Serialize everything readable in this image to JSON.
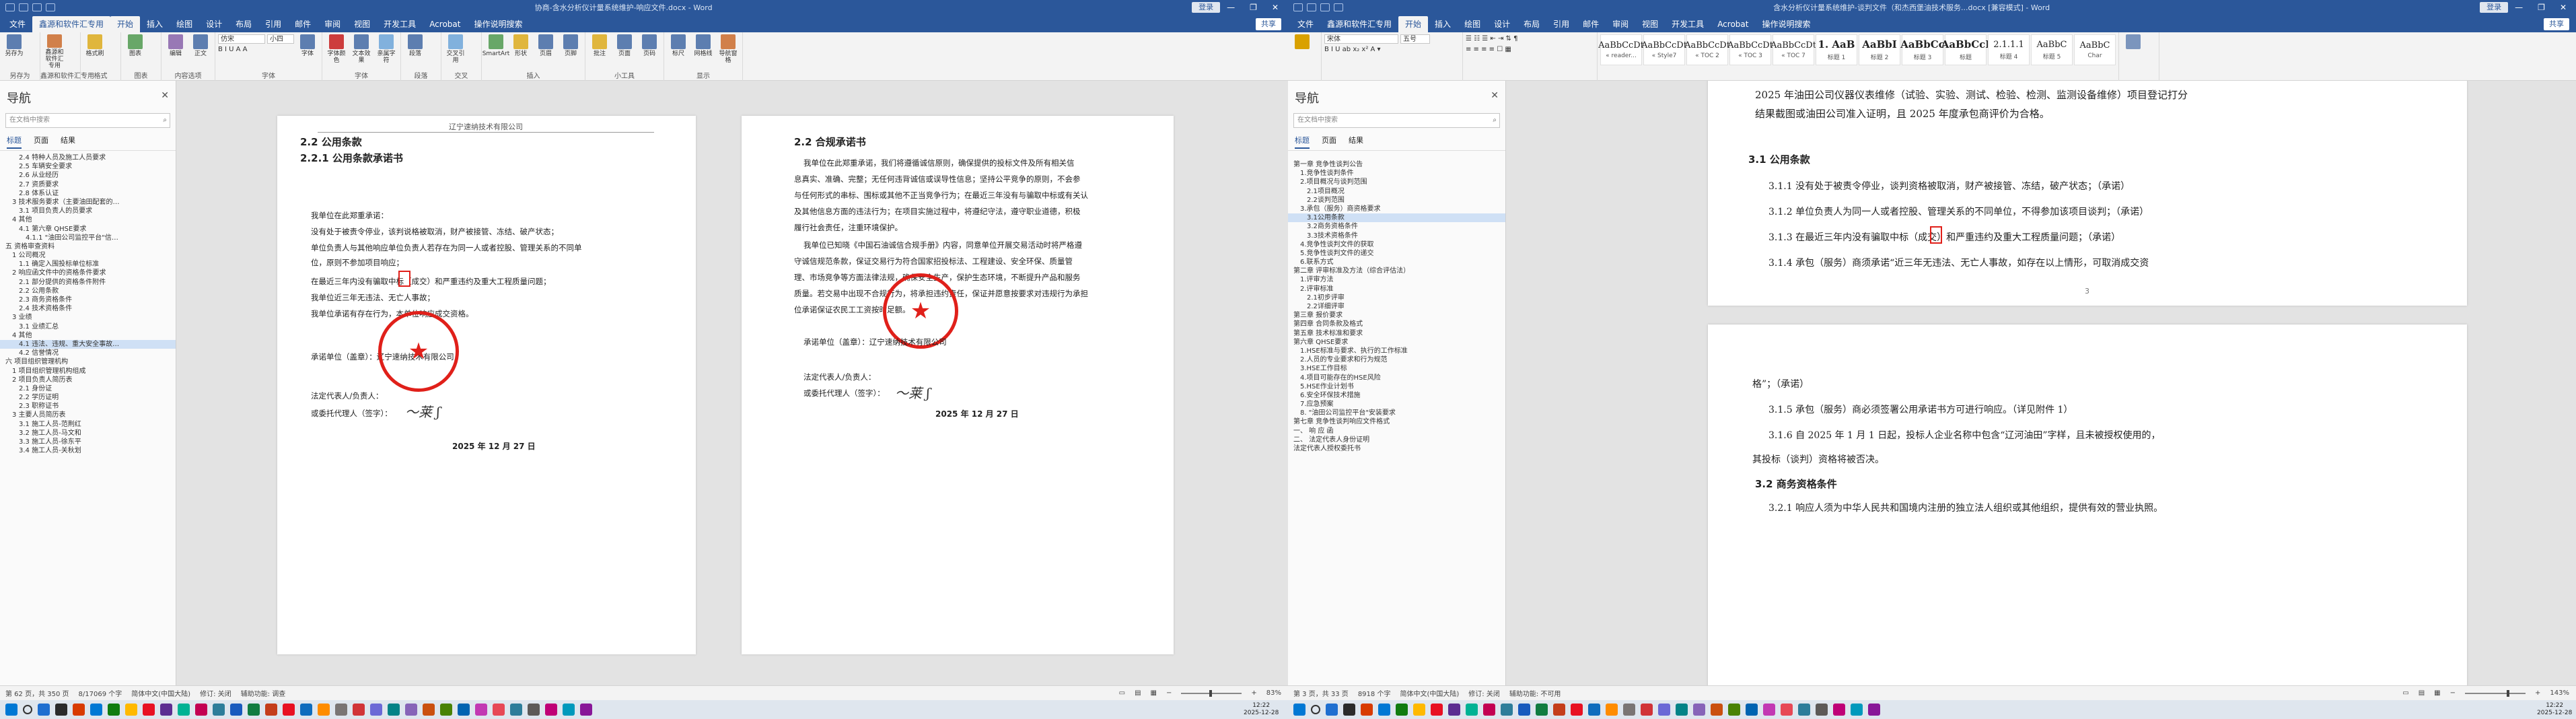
{
  "left": {
    "title": "协商-含水分析仪计量系统维护-响应文件.docx - Word",
    "account": "登录",
    "tabs": [
      "文件",
      "鑫源和软件汇专用",
      "开始",
      "插入",
      "绘图",
      "设计",
      "布局",
      "引用",
      "邮件",
      "审阅",
      "视图",
      "开发工具",
      "Acrobat",
      "操作说明搜索"
    ],
    "share": "共享",
    "ribbon_groups": [
      {
        "label": "另存为",
        "btns": [
          "另存为"
        ]
      },
      {
        "label": "鑫源和软件汇专用",
        "btns": [
          "鑫源和软件汇专用"
        ]
      },
      {
        "label": "格式",
        "btns": [
          "格式刷"
        ]
      },
      {
        "label": "图表",
        "btns": [
          "图表"
        ]
      },
      {
        "label": "内容选项",
        "btns": [
          "编辑",
          "正文"
        ]
      },
      {
        "label": "字体",
        "btns": [
          "字体"
        ]
      },
      {
        "label": "字体",
        "btns": [
          "字体颜色",
          "文本效果",
          "亲属字符"
        ]
      },
      {
        "label": "段落",
        "btns": [
          "段落"
        ]
      },
      {
        "label": "交叉",
        "btns": [
          "交叉引用"
        ]
      },
      {
        "label": "插入",
        "btns": [
          "SmartArt",
          "形状",
          "页眉",
          "页脚"
        ]
      },
      {
        "label": "小工具",
        "btns": [
          "批注",
          "页面",
          "页码"
        ]
      },
      {
        "label": "显示",
        "btns": [
          "标尺",
          "网格线",
          "导航窗格"
        ]
      }
    ],
    "font_name": "仿宋",
    "font_size": "小四",
    "nav": {
      "title": "导航",
      "search_placeholder": "在文档中搜索",
      "tabs": [
        "标题",
        "页面",
        "结果"
      ],
      "items": [
        "2.4 特种人员及施工人员要求",
        "2.5 车辆安全要求",
        "2.6 从业经历",
        "2.7 资质要求",
        "2.8 体系认证",
        "3 技术服务要求（主要油田配套的…",
        "3.1 项目负责人的员要求",
        "4 其他",
        "4.1 第六章 QHSE要求",
        "4.1.1 \"油田公司监控平台\"信…",
        "五 资格审查资料",
        "1 公司概况",
        "1.1 确定入围投标单位标准",
        "2 响应函文件中的资格条件要求",
        "2.1 部分提供的资格条件附件",
        "2.2 公用条款",
        "2.3 商务资格条件",
        "2.4 技术资格条件",
        "3 业绩",
        "3.1 业绩汇总",
        "4 其他",
        "4.1 违法、违规、重大安全事故…",
        "4.2 信誉情况",
        "六 项目组织管理机构",
        "1 项目组织管理机构组成",
        "2 项目负责人简历表",
        "2.1 身份证",
        "2.2 学历证明",
        "2.3 职称证书",
        "3 主要人员简历表",
        "3.1 施工人员-范荆红",
        "3.2 施工人员-马文和",
        "3.3 施工人员-徐东平",
        "3.4 施工人员-关秋划"
      ],
      "selected_index": 21
    },
    "page1": {
      "header": "辽宁速纳技术有限公司",
      "h1": "2.2  公用条款",
      "h2": "2.2.1 公用条款承诺书",
      "lines": [
        "我单位在此郑重承诺：",
        "没有处于被责令停业，该判说格被取消，财产被接管、冻结、破产状态；",
        "单位负责人与其他响应单位负责人若存在为同一人或者控股、管理关系的不同单",
        "位，原则不参加项目响应；",
        "在最近三年内没有骗取中标（成交）和严重违约及重大工程质量问题；",
        "我单位近三年无违法、无亡人事故；",
        "我单位承诺有存在行为，本单位响应成交资格。"
      ],
      "sign_unit": "承诺单位（盖章）：辽宁速纳技术有限公司",
      "legal_rep": "法定代表人/负责人：",
      "agent": "或委托代理人（签字）：",
      "date": "2025 年 12 月 27 日",
      "seal_text": "辽宁速纳技术有限公司"
    },
    "page2": {
      "h1": "2.2 合规承诺书",
      "lines": [
        "我单位在此郑重承诺，我们将遵循诚信原则，确保提供的投标文件及所有相关信",
        "息真实、准确、完整；无任何违背诚信或误导性信息；坚持公平竞争的原则，不会参",
        "与任何形式的串标、围标或其他不正当竞争行为；在最近三年没有与骗取中标或有关认",
        "及其他信息方面的违法行为；在项目实施过程中，将遵纪守法，遵守职业道德，积极",
        "履行社会责任，注重环境保护。",
        "我单位已知晓《中国石油诚信合规手册》内容，同意单位开展交易活动时将严格遵",
        "守诚信规范条款，保证交易行为符合国家招投标法、工程建设、安全环保、质量管",
        "理、市场竞争等方面法律法规，确保安全生产，保护生态环境，不断提升产品和服务",
        "质量。若交易中出现不合规行为，将承担违约责任，保证并愿意按要求对违规行为承担",
        "位承诺保证农民工工资按时足额。"
      ],
      "sign_unit": "承诺单位（盖章）：辽宁速纳技术有限公司",
      "legal_rep": "法定代表人/负责人：",
      "agent": "或委托代理人（签字）：",
      "date": "2025 年 12 月 27 日"
    },
    "status": {
      "page": "第 62 页，共 350 页",
      "words": "8/17069 个字",
      "lang": "简体中文(中国大陆)",
      "track": "修订: 关闭",
      "access": "辅助功能: 调查",
      "zoom": "83%"
    }
  },
  "right": {
    "title": "含水分析仪计量系统维护-谈判文件（和杰西堡油技术服务...docx [兼容模式] - Word",
    "account": "登录",
    "tabs": [
      "文件",
      "鑫源和软件汇专用",
      "开始",
      "插入",
      "绘图",
      "设计",
      "布局",
      "引用",
      "邮件",
      "审阅",
      "视图",
      "开发工具",
      "Acrobat",
      "操作说明搜索"
    ],
    "share": "共享",
    "styles": [
      {
        "preview": "AaBbCcDt",
        "name": "« reader..."
      },
      {
        "preview": "AaBbCcDt",
        "name": "« Style7"
      },
      {
        "preview": "AaBbCcDt",
        "name": "« TOC 2"
      },
      {
        "preview": "AaBbCcDt",
        "name": "« TOC 3"
      },
      {
        "preview": "AaBbCcDt",
        "name": "« TOC 7"
      },
      {
        "preview": "1. AaB",
        "name": "标题 1"
      },
      {
        "preview": "AaBbI",
        "name": "标题 2"
      },
      {
        "preview": "AaBbCc",
        "name": "标题 3"
      },
      {
        "preview": "AaBbCcI",
        "name": "标题"
      },
      {
        "preview": "2.1.1.1",
        "name": "标题 4"
      },
      {
        "preview": "AaBbC",
        "name": "标题 5"
      },
      {
        "preview": "AaBbC",
        "name": "Char"
      }
    ],
    "font_name": "宋体",
    "font_size": "五号",
    "nav": {
      "title": "导航",
      "search_placeholder": "在文档中搜索",
      "tabs": [
        "标题",
        "页面",
        "结果"
      ],
      "items": [
        "第一章 竞争性谈判公告",
        "1.竞争性谈判条件",
        "2.项目概况与谈判范围",
        "2.1项目概况",
        "2.2谈判范围",
        "3.承包（服务）商资格要求",
        "3.1公用条款",
        "3.2商务资格条件",
        "3.3技术资格条件",
        "4.竞争性谈判文件的获取",
        "5.竞争性谈判文件的递交",
        "6.联系方式",
        "第二章 评审标准及方法（综合评估法）",
        "1.评审方法",
        "2.评审标准",
        "2.1初步评审",
        "2.2详细评审",
        "第三章 报价要求",
        "第四章 合同条款及格式",
        "第五章 技术标准和要求",
        "第六章 QHSE要求",
        "1.HSE标准与要求、执行的工作标准",
        "2.人员的专业要求和行为规范",
        "3.HSE工作目标",
        "4.项目可能存在的HSE风险",
        "5.HSE作业计划书",
        "6.安全环保技术措施",
        "7.应急预案",
        "8. \"油田公司监控平台\"安装要求",
        "第七章 竞争性谈判响应文件格式",
        "一、 响 应 函",
        "二、 法定代表人身份证明",
        "法定代表人授权委托书"
      ],
      "selected_index": 6
    },
    "page3": {
      "lines": [
        "2025 年油田公司仪器仪表维修（试验、实验、测试、检验、检测、监测设备维修）项目登记打分",
        "结果截图或油田公司准入证明，且 2025 年度承包商评价为合格。"
      ],
      "h": "3.1 公用条款",
      "items": [
        "3.1.1 没有处于被责令停业，谈判资格被取消，财产被接管、冻结，破产状态；（承诺）",
        "3.1.2 单位负责人为同一人或者控股、管理关系的不同单位，不得参加该项目谈判；（承诺）",
        "3.1.3 在最近三年内没有骗取中标（成交）和严重违约及重大工程质量问题；（承诺）",
        "3.1.4 承包（服务）商须承诺“近三年无违法、无亡人事故，如存在以上情形，可取消成交资"
      ],
      "page_no": "3"
    },
    "page4": {
      "lines": [
        "格”；（承诺）",
        "3.1.5 承包（服务）商必须签署公用承诺书方可进行响应。（详见附件 1）",
        "3.1.6 自 2025 年 1 月 1 日起，投标人企业名称中包含“辽河油田”字样，且未被授权使用的，",
        "其投标（谈判）资格将被否决。"
      ],
      "h": "3.2 商务资格条件",
      "last": "3.2.1 响应人须为中华人民共和国境内注册的独立法人组织或其他组织，提供有效的营业执照。"
    },
    "status": {
      "page": "第 3 页，共 33 页",
      "words": "8918 个字",
      "lang": "简体中文(中国大陆)",
      "track": "修订: 关闭",
      "access": "辅助功能: 不可用",
      "zoom": "143%"
    }
  },
  "taskbar": {
    "time": "12:22",
    "date": "2025-12-28"
  },
  "colors": {
    "word_blue": "#2b579a",
    "seal_red": "#e0201a",
    "search_orange": "#c55a11"
  }
}
